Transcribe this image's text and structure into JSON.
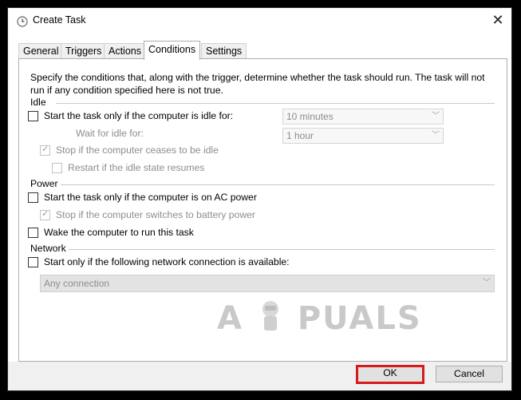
{
  "window": {
    "title": "Create Task",
    "close_glyph": "✕"
  },
  "tabs": [
    {
      "label": "General"
    },
    {
      "label": "Triggers"
    },
    {
      "label": "Actions"
    },
    {
      "label": "Conditions"
    },
    {
      "label": "Settings"
    }
  ],
  "active_tab": "Conditions",
  "description": "Specify the conditions that, along with the trigger, determine whether the task should run.  The task will not run  if any condition specified here is not true.",
  "idle": {
    "label": "Idle",
    "start_idle": {
      "label": "Start the task only if the computer is idle for:",
      "checked": false
    },
    "idle_for_value": "10 minutes",
    "wait_label": "Wait for idle for:",
    "wait_value": "1 hour",
    "stop_idle": {
      "label": "Stop if the computer ceases to be idle",
      "checked": true,
      "enabled": false
    },
    "restart_idle": {
      "label": "Restart if the idle state resumes",
      "checked": false,
      "enabled": false
    }
  },
  "power": {
    "label": "Power",
    "ac_power": {
      "label": "Start the task only if the computer is on AC power",
      "checked": false
    },
    "battery": {
      "label": "Stop if the computer switches to battery power",
      "checked": true,
      "enabled": false
    },
    "wake": {
      "label": "Wake the computer to run this task",
      "checked": false
    }
  },
  "network": {
    "label": "Network",
    "start_network": {
      "label": "Start only if the following network connection is available:",
      "checked": false
    },
    "connection_value": "Any connection"
  },
  "watermark": {
    "text_left": "A",
    "text_right": "PUALS"
  },
  "buttons": {
    "ok": "OK",
    "cancel": "Cancel"
  },
  "icons": {
    "title_icon": "clock-icon",
    "chevron": "chevron-down-icon",
    "check": "checkmark-icon"
  },
  "colors": {
    "highlight_border": "#d81a1a"
  }
}
